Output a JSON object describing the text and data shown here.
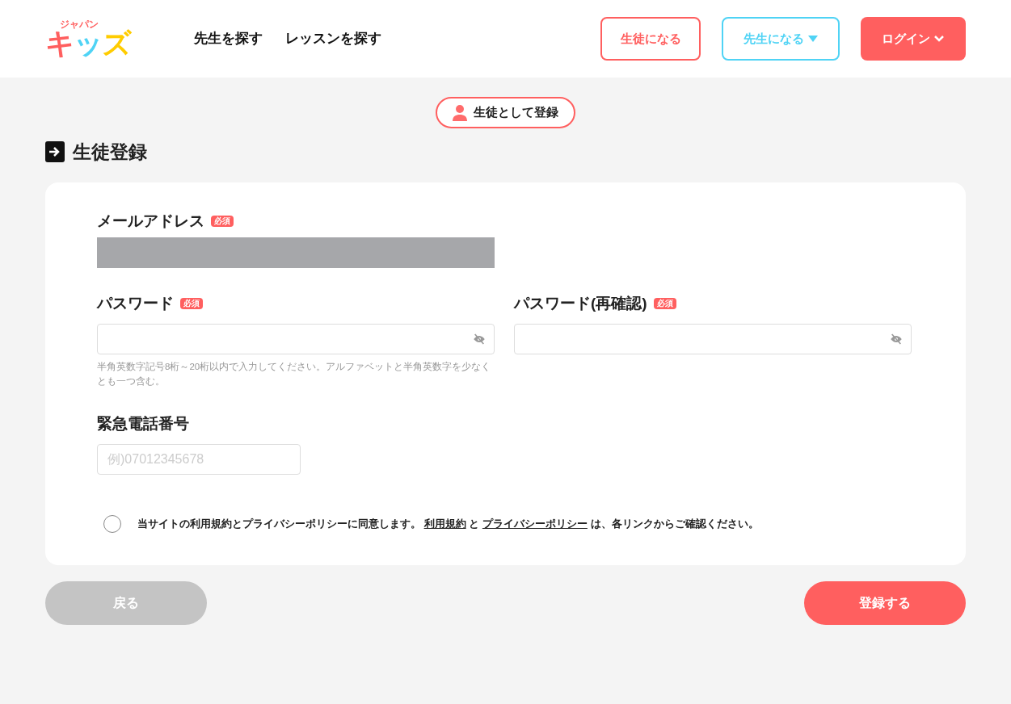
{
  "header": {
    "logo": {
      "small": "ジャパン",
      "main": "キッズ"
    },
    "nav": [
      "先生を探す",
      "レッスンを探す"
    ],
    "buttons": [
      {
        "label": "生徒になる",
        "kind": "outline-red"
      },
      {
        "label": "先生になる",
        "kind": "outline-blue"
      },
      {
        "label": "ログイン",
        "kind": "solid"
      }
    ]
  },
  "role_badge": "生徒として登録",
  "page_title": "生徒登録",
  "form": {
    "email": {
      "label": "メールアドレス",
      "required": "必須"
    },
    "password": {
      "label": "パスワード",
      "required": "必須",
      "hint": "半角英数字記号8桁～20桁以内で入力してください。アルファベットと半角英数字を少なくとも一つ含む。"
    },
    "password_confirm": {
      "label": "パスワード(再確認)",
      "required": "必須"
    },
    "phone": {
      "label": "緊急電話番号",
      "placeholder": "例)07012345678"
    },
    "agree": {
      "checked": false,
      "before": "当サイトの利用規約とプライバシーポリシーに同意します。",
      "link1": "利用規約",
      "middle": "と",
      "link2": "プライバシーポリシー",
      "after": "は、各リンクからご確認ください。"
    }
  },
  "actions": {
    "back": "戻る",
    "submit": "登録する"
  }
}
